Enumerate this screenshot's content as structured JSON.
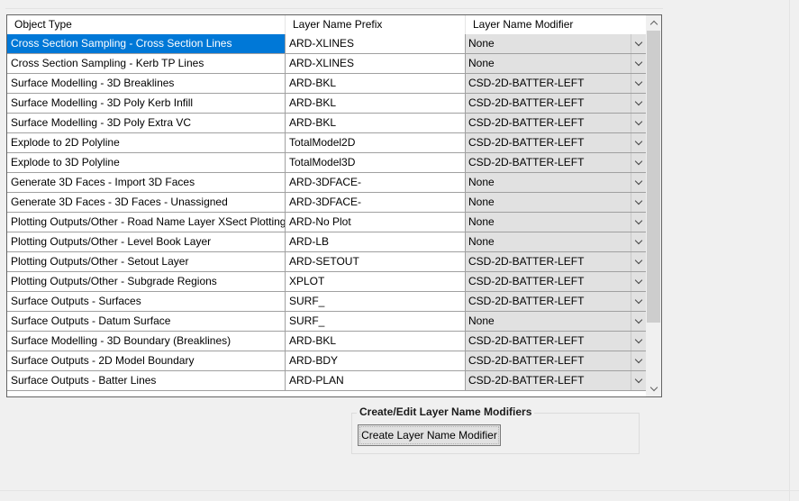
{
  "table": {
    "columns": [
      "Object Type",
      "Layer Name Prefix",
      "Layer Name Modifier"
    ],
    "rows": [
      {
        "object_type": "Cross Section Sampling - Cross Section Lines",
        "prefix": "ARD-XLINES",
        "modifier": "None"
      },
      {
        "object_type": "Cross Section Sampling - Kerb TP Lines",
        "prefix": "ARD-XLINES",
        "modifier": "None"
      },
      {
        "object_type": "Surface Modelling - 3D Breaklines",
        "prefix": "ARD-BKL",
        "modifier": "CSD-2D-BATTER-LEFT"
      },
      {
        "object_type": "Surface Modelling - 3D Poly Kerb Infill",
        "prefix": "ARD-BKL",
        "modifier": "CSD-2D-BATTER-LEFT"
      },
      {
        "object_type": "Surface Modelling - 3D Poly Extra VC",
        "prefix": "ARD-BKL",
        "modifier": "CSD-2D-BATTER-LEFT"
      },
      {
        "object_type": "Explode to 2D Polyline",
        "prefix": "TotalModel2D",
        "modifier": "CSD-2D-BATTER-LEFT"
      },
      {
        "object_type": "Explode to 3D Polyline",
        "prefix": "TotalModel3D",
        "modifier": "CSD-2D-BATTER-LEFT"
      },
      {
        "object_type": "Generate 3D Faces - Import 3D Faces",
        "prefix": "ARD-3DFACE-",
        "modifier": "None"
      },
      {
        "object_type": "Generate 3D Faces - 3D Faces - Unassigned",
        "prefix": "ARD-3DFACE-",
        "modifier": "None"
      },
      {
        "object_type": "Plotting Outputs/Other - Road Name Layer XSect Plotting",
        "prefix": "ARD-No Plot",
        "modifier": "None"
      },
      {
        "object_type": "Plotting Outputs/Other - Level Book Layer",
        "prefix": "ARD-LB",
        "modifier": "None"
      },
      {
        "object_type": "Plotting Outputs/Other - Setout Layer",
        "prefix": "ARD-SETOUT",
        "modifier": "CSD-2D-BATTER-LEFT"
      },
      {
        "object_type": "Plotting Outputs/Other - Subgrade Regions",
        "prefix": "XPLOT",
        "modifier": "CSD-2D-BATTER-LEFT"
      },
      {
        "object_type": "Surface Outputs - Surfaces",
        "prefix": "SURF_",
        "modifier": "CSD-2D-BATTER-LEFT"
      },
      {
        "object_type": "Surface Outputs - Datum Surface",
        "prefix": "SURF_",
        "modifier": "None"
      },
      {
        "object_type": "Surface Modelling - 3D Boundary (Breaklines)",
        "prefix": "ARD-BKL",
        "modifier": "CSD-2D-BATTER-LEFT"
      },
      {
        "object_type": "Surface Outputs - 2D Model Boundary",
        "prefix": "ARD-BDY",
        "modifier": "CSD-2D-BATTER-LEFT"
      },
      {
        "object_type": "Surface Outputs - Batter Lines",
        "prefix": "ARD-PLAN",
        "modifier": "CSD-2D-BATTER-LEFT"
      }
    ]
  },
  "modifiers_group": {
    "title": "Create/Edit Layer Name Modifiers",
    "button_label": "Create Layer Name Modifier"
  }
}
